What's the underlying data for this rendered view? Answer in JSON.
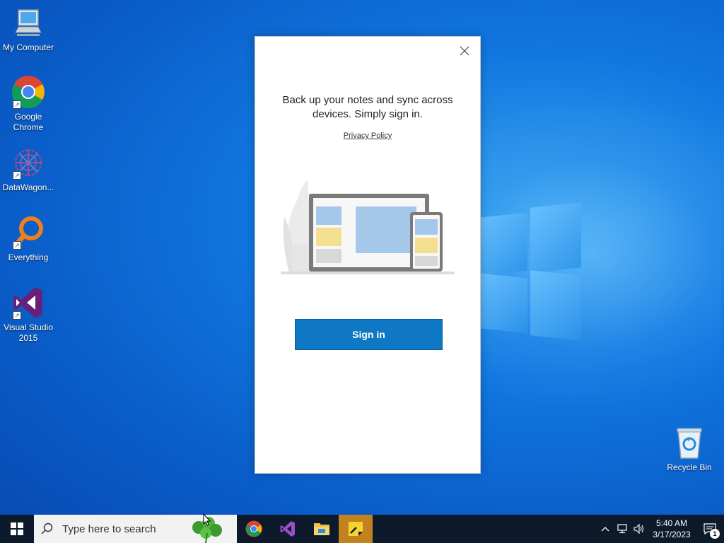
{
  "desktop": {
    "icons": [
      {
        "label": "My Computer"
      },
      {
        "label": "Google Chrome"
      },
      {
        "label": "DataWagon..."
      },
      {
        "label": "Everything"
      },
      {
        "label": "Visual Studio 2015"
      },
      {
        "label": "Recycle Bin"
      }
    ]
  },
  "dialog": {
    "title": "Back up your notes and sync across devices. Simply sign in.",
    "privacy_link": "Privacy Policy",
    "signin_label": "Sign in",
    "accent_color": "#0f78c4"
  },
  "taskbar": {
    "search_placeholder": "Type here to search",
    "pinned_apps": [
      "chrome-icon",
      "visual-studio-icon",
      "file-explorer-icon",
      "sticky-notes-icon"
    ],
    "active_app": "sticky-notes-icon",
    "active_color": "#c2831e",
    "clock": {
      "time": "5:40 AM",
      "date": "3/17/2023"
    },
    "notification_count": "1"
  }
}
